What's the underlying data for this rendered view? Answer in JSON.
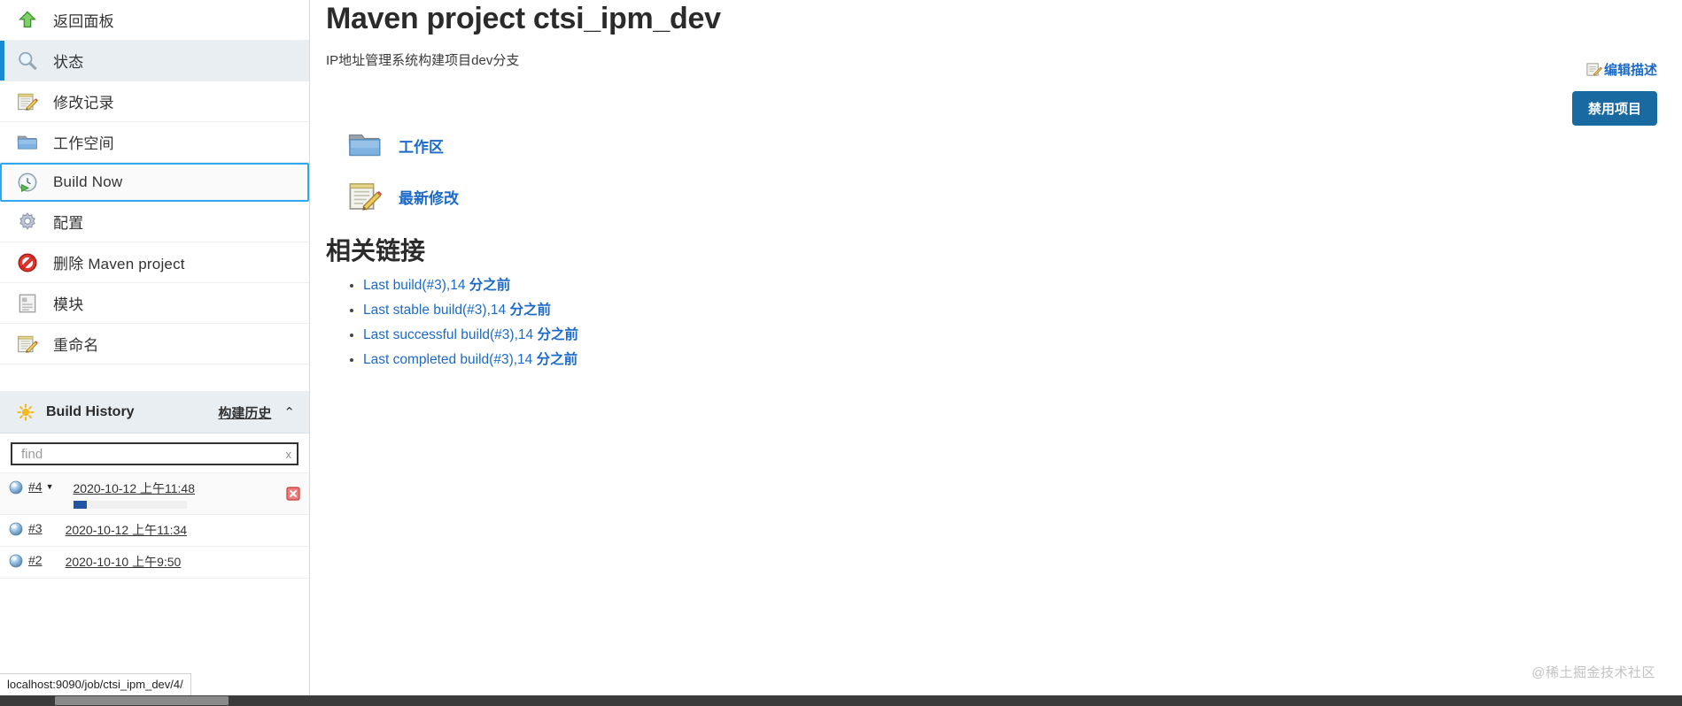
{
  "sidebar": {
    "tasks": [
      {
        "label": "返回面板",
        "icon": "up-arrow-icon",
        "state": "normal",
        "name": "sidebar-item-back-to-dashboard"
      },
      {
        "label": "状态",
        "icon": "magnifier-icon",
        "state": "selected",
        "name": "sidebar-item-status"
      },
      {
        "label": "修改记录",
        "icon": "notepad-pencil-icon",
        "state": "normal",
        "name": "sidebar-item-changes"
      },
      {
        "label": "工作空间",
        "icon": "folder-icon",
        "state": "normal",
        "name": "sidebar-item-workspace"
      },
      {
        "label": "Build Now",
        "icon": "build-clock-icon",
        "state": "focused",
        "name": "sidebar-item-build-now"
      },
      {
        "label": "配置",
        "icon": "gear-icon",
        "state": "normal",
        "name": "sidebar-item-configure"
      },
      {
        "label": "删除 Maven project",
        "icon": "no-entry-icon",
        "state": "normal",
        "name": "sidebar-item-delete-project"
      },
      {
        "label": "模块",
        "icon": "module-page-icon",
        "state": "normal",
        "name": "sidebar-item-modules"
      },
      {
        "label": "重命名",
        "icon": "notepad-pencil-icon",
        "state": "normal",
        "name": "sidebar-item-rename"
      }
    ],
    "build_history": {
      "title": "Build History",
      "title_cn": "构建历史",
      "collapse_glyph": "⌃",
      "icon": "sun-icon",
      "find": {
        "value": "",
        "placeholder": "find",
        "clear_label": "x"
      },
      "builds": [
        {
          "id": "#4",
          "time": "2020-10-12 上午11:48",
          "status": "in-progress",
          "has_caret": true,
          "progress_percent": 12,
          "stop_icon": "stop-build-icon"
        },
        {
          "id": "#3",
          "time": "2020-10-12 上午11:34",
          "status": "in-progress",
          "has_caret": false,
          "progress_percent": null,
          "stop_icon": null
        },
        {
          "id": "#2",
          "time": "2020-10-10 上午9:50",
          "status": "in-progress",
          "has_caret": false,
          "progress_percent": null,
          "stop_icon": null
        }
      ]
    },
    "url_hint": "localhost:9090/job/ctsi_ipm_dev/4/"
  },
  "main": {
    "title": "Maven project ctsi_ipm_dev",
    "description": "IP地址管理系统构建项目dev分支",
    "edit_description_label": "编辑描述",
    "edit_description_icon": "notepad-pencil-icon",
    "disable_project_label": "禁用项目",
    "big_links": [
      {
        "label": "工作区",
        "icon": "folder-icon",
        "name": "workspace-link"
      },
      {
        "label": "最新修改",
        "icon": "notepad-pencil-icon",
        "name": "recent-changes-link"
      }
    ],
    "related_heading": "相关链接",
    "related_links": [
      {
        "text": "Last build(#3),14 ",
        "ago": "分之前"
      },
      {
        "text": "Last stable build(#3),14 ",
        "ago": "分之前"
      },
      {
        "text": "Last successful build(#3),14 ",
        "ago": "分之前"
      },
      {
        "text": "Last completed build(#3),14 ",
        "ago": "分之前"
      }
    ],
    "watermark": "@稀土掘金技术社区"
  },
  "colors": {
    "accent_blue": "#1b6ac9",
    "button_blue": "#1a6aa2",
    "selected_bar": "#1b8bd0",
    "focus_outline": "#2ea8f0",
    "progress_fill": "#2255a4",
    "panel_bg": "#e8eef2"
  }
}
